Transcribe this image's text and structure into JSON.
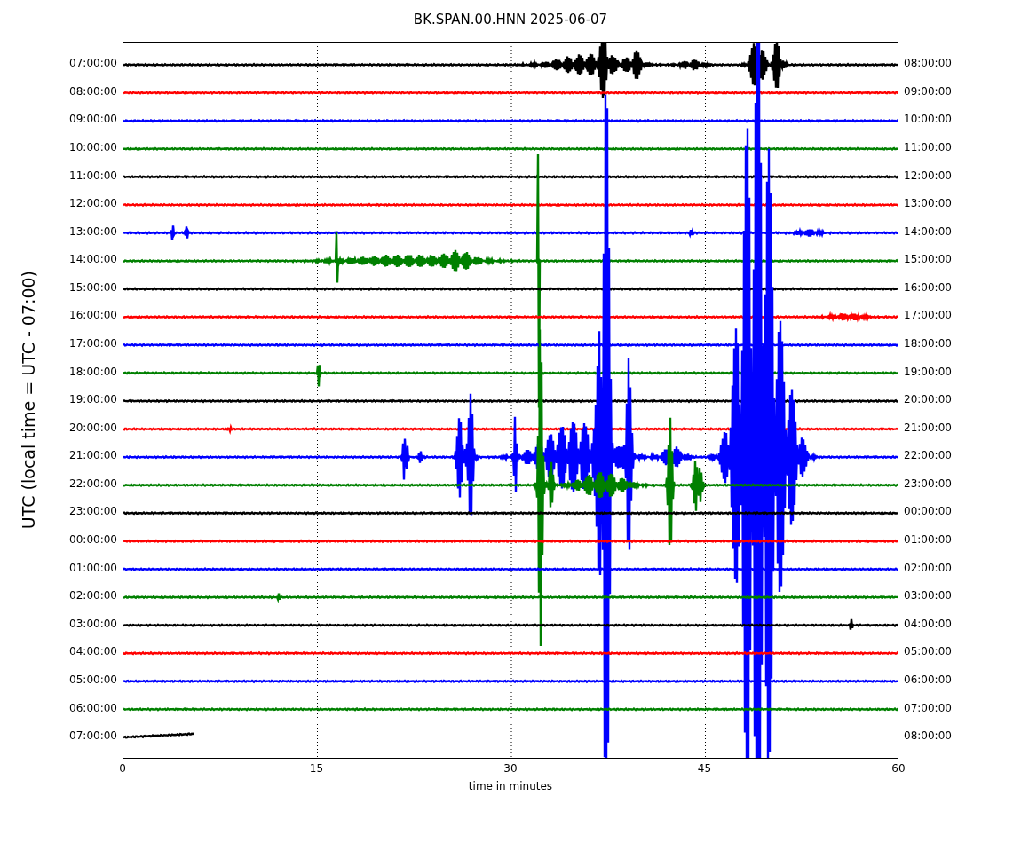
{
  "title": "BK.SPAN.00.HNN 2025-06-07",
  "ylabel": "UTC (local time = UTC - 07:00)",
  "xlabel": "time in minutes",
  "xticks": [
    "0",
    "15",
    "30",
    "45",
    "60"
  ],
  "rows": [
    {
      "left": "07:00:00",
      "right": "08:00:00",
      "color": "#000000"
    },
    {
      "left": "08:00:00",
      "right": "09:00:00",
      "color": "#ff0000"
    },
    {
      "left": "09:00:00",
      "right": "10:00:00",
      "color": "#0000ff"
    },
    {
      "left": "10:00:00",
      "right": "11:00:00",
      "color": "#008000"
    },
    {
      "left": "11:00:00",
      "right": "12:00:00",
      "color": "#000000"
    },
    {
      "left": "12:00:00",
      "right": "13:00:00",
      "color": "#ff0000"
    },
    {
      "left": "13:00:00",
      "right": "14:00:00",
      "color": "#0000ff"
    },
    {
      "left": "14:00:00",
      "right": "15:00:00",
      "color": "#008000"
    },
    {
      "left": "15:00:00",
      "right": "16:00:00",
      "color": "#000000"
    },
    {
      "left": "16:00:00",
      "right": "17:00:00",
      "color": "#ff0000"
    },
    {
      "left": "17:00:00",
      "right": "18:00:00",
      "color": "#0000ff"
    },
    {
      "left": "18:00:00",
      "right": "19:00:00",
      "color": "#008000"
    },
    {
      "left": "19:00:00",
      "right": "20:00:00",
      "color": "#000000"
    },
    {
      "left": "20:00:00",
      "right": "21:00:00",
      "color": "#ff0000"
    },
    {
      "left": "21:00:00",
      "right": "22:00:00",
      "color": "#0000ff"
    },
    {
      "left": "22:00:00",
      "right": "23:00:00",
      "color": "#008000"
    },
    {
      "left": "23:00:00",
      "right": "00:00:00",
      "color": "#000000"
    },
    {
      "left": "00:00:00",
      "right": "01:00:00",
      "color": "#ff0000"
    },
    {
      "left": "01:00:00",
      "right": "02:00:00",
      "color": "#0000ff"
    },
    {
      "left": "02:00:00",
      "right": "03:00:00",
      "color": "#008000"
    },
    {
      "left": "03:00:00",
      "right": "04:00:00",
      "color": "#000000"
    },
    {
      "left": "04:00:00",
      "right": "05:00:00",
      "color": "#ff0000"
    },
    {
      "left": "05:00:00",
      "right": "06:00:00",
      "color": "#0000ff"
    },
    {
      "left": "06:00:00",
      "right": "07:00:00",
      "color": "#008000"
    },
    {
      "left": "07:00:00",
      "right": "08:00:00",
      "color": "#000000"
    }
  ]
}
